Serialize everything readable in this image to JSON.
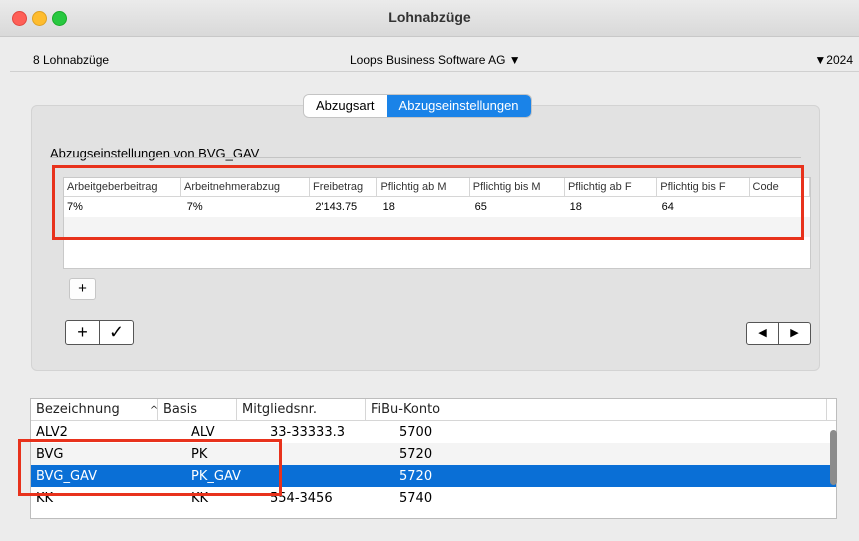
{
  "window": {
    "title": "Lohnabzüge"
  },
  "infobar": {
    "left": "8 Lohnabzüge",
    "company": "Loops Business Software AG ▼",
    "year": "▼2024"
  },
  "tabs": [
    "Abzugsart",
    "Abzugseinstellungen"
  ],
  "active_tab": "Abzugseinstellungen",
  "section_title": "Abzugseinstellungen von BVG_GAV",
  "settings_table": {
    "headers": [
      "Arbeitgeberbeitrag",
      "Arbeitnehmerabzug",
      "Freibetrag",
      "Pflichtig ab M",
      "Pflichtig bis M",
      "Pflichtig ab F",
      "Pflichtig bis F",
      "Code"
    ],
    "rows": [
      [
        "7%",
        "7%",
        "2'143.75",
        "18",
        "65",
        "18",
        "64",
        ""
      ]
    ]
  },
  "buttons": {
    "plus": "+",
    "add": "+",
    "confirm": "✓",
    "prev": "◀",
    "next": "▶"
  },
  "deductions_table": {
    "headers": [
      "Bezeichnung",
      "Basis",
      "Mitgliedsnr.",
      "FiBu-Konto"
    ],
    "sort_indicator": "^",
    "rows": [
      [
        "ALV2",
        "ALV",
        "33-33333.3",
        "5700"
      ],
      [
        "BVG",
        "PK",
        "",
        "5720"
      ],
      [
        "BVG_GAV",
        "PK_GAV",
        "",
        "5720"
      ],
      [
        "KK",
        "KK",
        "554-3456",
        "5740"
      ]
    ],
    "selected_index": 2
  },
  "colors": {
    "selection": "#0a6fd6",
    "highlight": "#e8321c",
    "segment_active": "#1a83e8"
  }
}
